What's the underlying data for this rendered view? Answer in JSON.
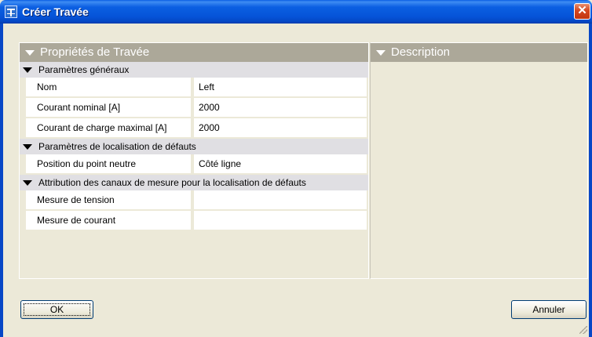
{
  "window": {
    "title": "Créer Travée",
    "close_glyph": "✕"
  },
  "properties_panel": {
    "title": "Propriétés de Travée",
    "groups": [
      {
        "label": "Paramètres généraux",
        "rows": [
          {
            "key": "Nom",
            "value": "Left"
          },
          {
            "key": "Courant nominal [A]",
            "value": "2000"
          },
          {
            "key": "Courant de charge maximal [A]",
            "value": "2000"
          }
        ]
      },
      {
        "label": "Paramètres de localisation de défauts",
        "rows": [
          {
            "key": "Position du point neutre",
            "value": "Côté ligne"
          }
        ]
      },
      {
        "label": "Attribution des canaux de mesure pour la localisation de défauts",
        "rows": [
          {
            "key": "Mesure de tension",
            "value": ""
          },
          {
            "key": "Mesure de courant",
            "value": ""
          }
        ]
      }
    ]
  },
  "description_panel": {
    "title": "Description"
  },
  "buttons": {
    "ok": "OK",
    "cancel": "Annuler"
  }
}
